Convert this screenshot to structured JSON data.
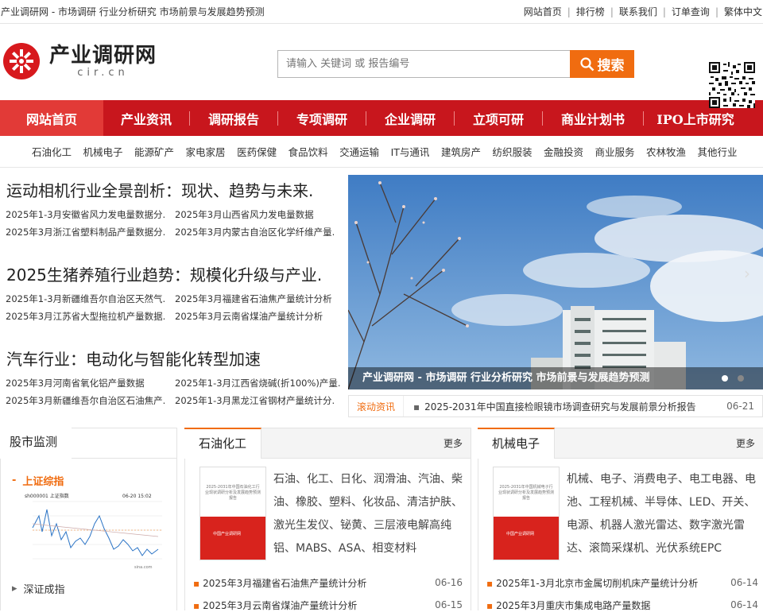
{
  "topbar": {
    "slogan": "产业调研网 - 市场调研 行业分析研究 市场前景与发展趋势预测",
    "links": [
      "网站首页",
      "排行榜",
      "联系我们",
      "订单查询",
      "繁体中文"
    ]
  },
  "logo": {
    "cn": "产业调研网",
    "en": "cir.cn"
  },
  "search": {
    "placeholder": "请输入 关键词 或 报告编号",
    "button": "搜索"
  },
  "nav": [
    "网站首页",
    "产业资讯",
    "调研报告",
    "专项调研",
    "企业调研",
    "立项可研",
    "商业计划书",
    "IPO上市研究"
  ],
  "subnav": [
    "石油化工",
    "机械电子",
    "能源矿产",
    "家电家居",
    "医药保健",
    "食品饮料",
    "交通运输",
    "IT与通讯",
    "建筑房产",
    "纺织服装",
    "金融投资",
    "商业服务",
    "农林牧渔",
    "其他行业"
  ],
  "headlines": [
    {
      "title": "运动相机行业全景剖析：现状、趋势与未来.",
      "links": [
        "2025年1-3月安徽省风力发电量数据分.",
        "2025年3月山西省风力发电量数据",
        "2025年3月浙江省塑料制品产量数据分.",
        "2025年3月内蒙古自治区化学纤维产量."
      ]
    },
    {
      "title": "2025生猪养殖行业趋势：规模化升级与产业.",
      "links": [
        "2025年1-3月新疆维吾尔自治区天然气.",
        "2025年3月福建省石油焦产量统计分析",
        "2025年3月江苏省大型拖拉机产量数据.",
        "2025年3月云南省煤油产量统计分析"
      ]
    },
    {
      "title": "汽车行业：电动化与智能化转型加速",
      "links": [
        "2025年3月河南省氧化铝产量数据",
        "2025年1-3月江西省烧碱(折100%)产量.",
        "2025年3月新疆维吾尔自治区石油焦产.",
        "2025年1-3月黑龙江省钢材产量统计分."
      ]
    }
  ],
  "banner": {
    "caption": "产业调研网 - 市场调研 行业分析研究 市场前景与发展趋势预测",
    "arrow": "›"
  },
  "scroll": {
    "tag": "滚动资讯",
    "bullet": "▪",
    "text": "2025-2031年中国直接检眼镜市场调查研究与发展前景分析报告",
    "date": "06-21"
  },
  "stock": {
    "title": "股市监测",
    "items": [
      {
        "label": "上证综指",
        "prefix": "-"
      },
      {
        "label": "深证成指",
        "prefix": "▸"
      }
    ],
    "chart_labels": {
      "code": "sh000001 上证指数",
      "time": "06-20 15:02",
      "source": "sina.com"
    }
  },
  "sectors": [
    {
      "title": "石油化工",
      "more": "更多",
      "cover_text": "2025-2031年中国石油化工行业现状调研分析及发展趋势预测报告",
      "cover_brand": "中国产业调研网",
      "keywords": "石油、化工、日化、润滑油、汽油、柴油、橡胶、塑料、化妆品、清洁护肤、激光生发仪、铋黄、三层液电解高纯铝、MABS、ASA、相变材料",
      "news": [
        {
          "text": "2025年3月福建省石油焦产量统计分析",
          "date": "06-16"
        },
        {
          "text": "2025年3月云南省煤油产量统计分析",
          "date": "06-15"
        }
      ]
    },
    {
      "title": "机械电子",
      "more": "更多",
      "cover_text": "2025-2031年中国机械电子行业现状调研分析及发展趋势预测报告",
      "cover_brand": "中国产业调研网",
      "keywords": "机械、电子、消费电子、电工电器、电池、工程机械、半导体、LED、开关、电源、机器人激光雷达、数字激光雷达、滚筒采煤机、光伏系统EPC",
      "news": [
        {
          "text": "2025年1-3月北京市金属切削机床产量统计分析",
          "date": "06-14"
        },
        {
          "text": "2025年3月重庆市集成电路产量数据",
          "date": "06-14"
        }
      ]
    }
  ],
  "colors": {
    "brand_red": "#c8161d",
    "accent_orange": "#f06c10"
  }
}
